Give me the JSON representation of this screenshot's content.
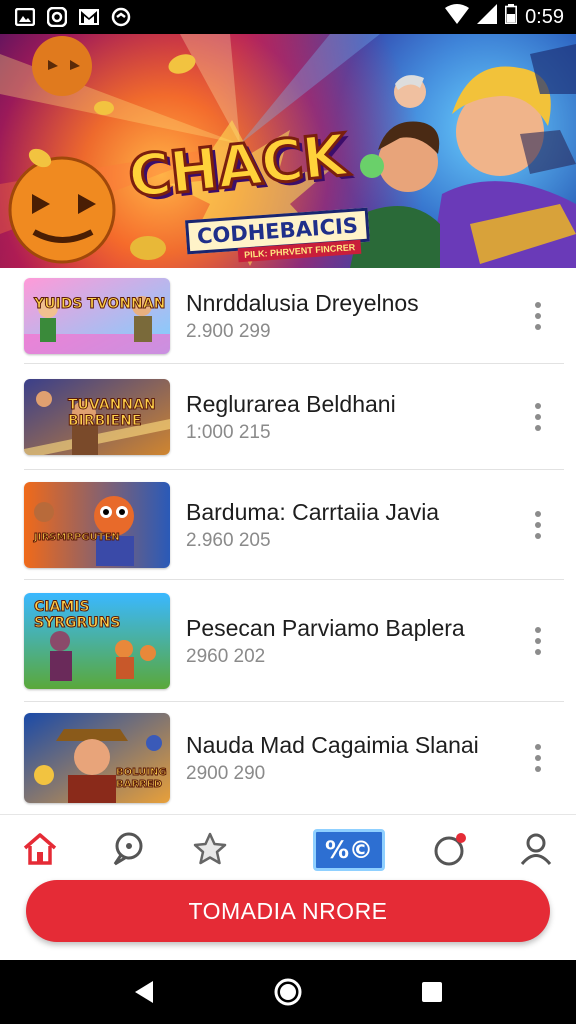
{
  "status_bar": {
    "time": "0:59",
    "left_icons": [
      "photo-icon",
      "instagram-icon",
      "gmail-icon",
      "sync-icon"
    ],
    "right_icons": [
      "wifi-icon",
      "signal-icon",
      "battery-icon"
    ]
  },
  "banner": {
    "title": "CHACK",
    "subtitle": "CODHEBAICIS",
    "tag": "PILK: PHRVENT FINCRER"
  },
  "games": [
    {
      "title": "Nnrddalusia Dreyelnos",
      "sub": "2.900 299",
      "thumb_text": "YUIDS TVONNAN",
      "thumb_colors": [
        "#ff9ad8",
        "#7ad0ff"
      ]
    },
    {
      "title": "Reglurarea Beldhani",
      "sub": "1:000 215",
      "thumb_text": "TUVANNAN BIRBIENE",
      "thumb_colors": [
        "#3a3f8a",
        "#d98a2a"
      ]
    },
    {
      "title": "Barduma: Carrtaiia Javia",
      "sub": "2.960 205",
      "thumb_text": "JIRSMRPGUTEN",
      "thumb_colors": [
        "#f06a1a",
        "#2a5ab8"
      ]
    },
    {
      "title": "Pesecan Parviamo Baplera",
      "sub": "2960 202",
      "thumb_text": "CIAMIS SYRGRUNS",
      "thumb_colors": [
        "#3ab8ff",
        "#5aa83a"
      ]
    },
    {
      "title": "Nauda Mad Cagaimia Slanai",
      "sub": "2900 290",
      "thumb_text": "BOLUING BARRED",
      "thumb_colors": [
        "#1a4aa8",
        "#e8a03a"
      ]
    }
  ],
  "bottom_nav": {
    "items": [
      "home-icon",
      "chat-icon",
      "star-icon",
      "rewards-badge",
      "notification-icon",
      "profile-icon"
    ],
    "badge_text": "%©"
  },
  "cta": {
    "label": "TOMADIA NRORE"
  },
  "colors": {
    "accent": "#e52b36",
    "badge_blue": "#2d6fd2"
  }
}
